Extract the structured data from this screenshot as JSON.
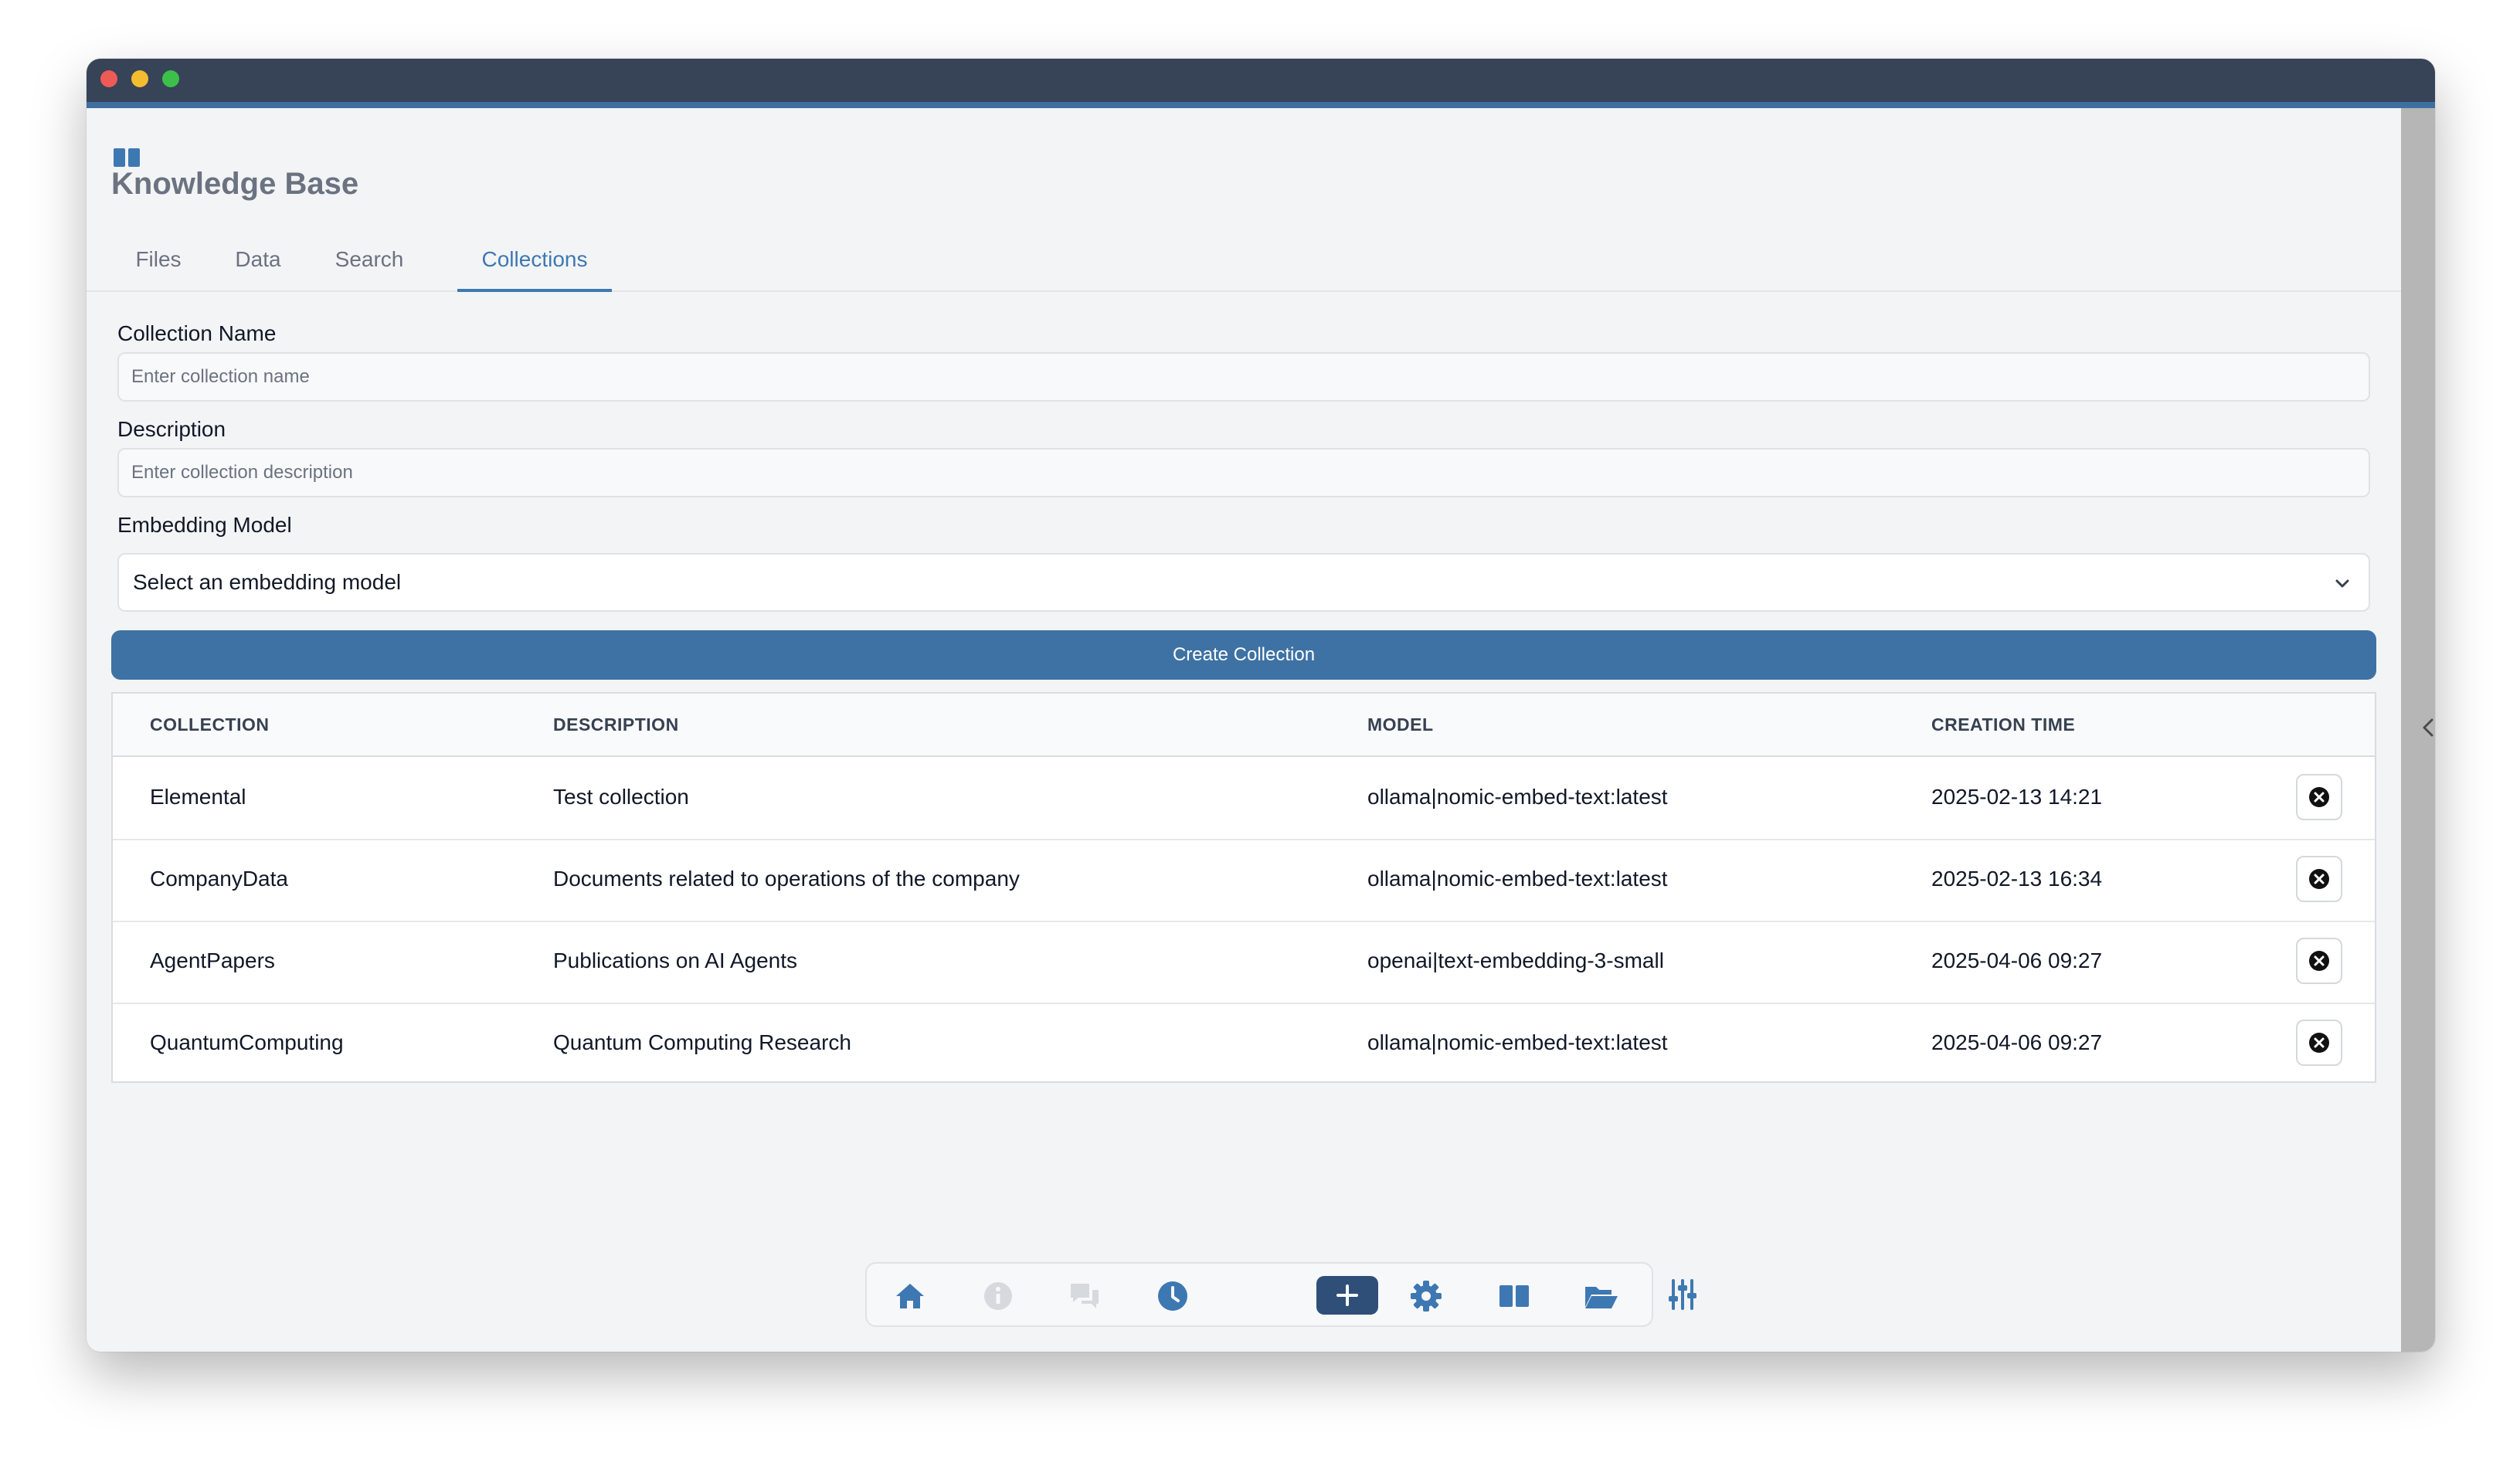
{
  "app": {
    "page_title": "Knowledge Base"
  },
  "tabs": [
    {
      "label": "Files",
      "active": false
    },
    {
      "label": "Data",
      "active": false
    },
    {
      "label": "Search",
      "active": false
    },
    {
      "label": "Collections",
      "active": true
    }
  ],
  "form": {
    "name_label": "Collection Name",
    "name_placeholder": "Enter collection name",
    "name_value": "",
    "description_label": "Description",
    "description_placeholder": "Enter collection description",
    "description_value": "",
    "model_label": "Embedding Model",
    "model_selected": "Select an embedding model",
    "create_label": "Create Collection"
  },
  "table": {
    "headers": [
      "COLLECTION",
      "DESCRIPTION",
      "MODEL",
      "CREATION TIME"
    ],
    "rows": [
      {
        "collection": "Elemental",
        "description": "Test collection",
        "model": "ollama|nomic-embed-text:latest",
        "created": "2025-02-13 14:21"
      },
      {
        "collection": "CompanyData",
        "description": "Documents related to operations of the company",
        "model": "ollama|nomic-embed-text:latest",
        "created": "2025-02-13 16:34"
      },
      {
        "collection": "AgentPapers",
        "description": "Publications on AI Agents",
        "model": "openai|text-embedding-3-small",
        "created": "2025-04-06 09:27"
      },
      {
        "collection": "QuantumComputing",
        "description": "Quantum Computing Research",
        "model": "ollama|nomic-embed-text:latest",
        "created": "2025-04-06 09:27"
      }
    ]
  },
  "bottom_nav": [
    {
      "icon": "home-icon",
      "enabled": true
    },
    {
      "icon": "info-icon",
      "enabled": false
    },
    {
      "icon": "chat-icon",
      "enabled": false
    },
    {
      "icon": "clock-icon",
      "enabled": true
    },
    {
      "icon": "plus-icon",
      "enabled": true
    },
    {
      "icon": "gear-icon",
      "enabled": true
    },
    {
      "icon": "book-icon",
      "enabled": true
    },
    {
      "icon": "folder-icon",
      "enabled": true
    },
    {
      "icon": "sliders-icon",
      "enabled": true
    }
  ],
  "colors": {
    "accent": "#3e78b2",
    "titlebar": "#374357",
    "button": "#3e72a4"
  }
}
